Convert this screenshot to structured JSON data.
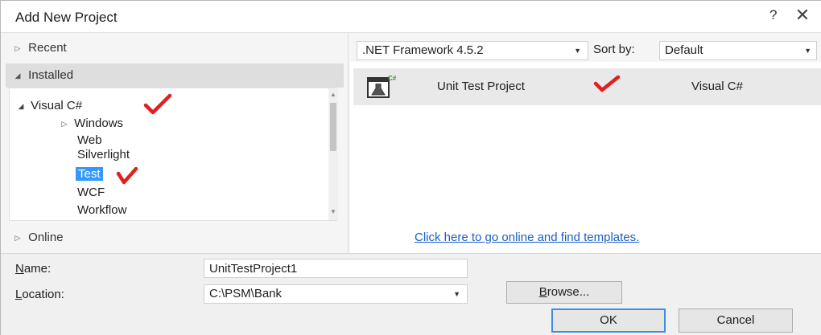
{
  "window": {
    "title": "Add New Project",
    "help_label": "?",
    "close_label": "✕"
  },
  "left": {
    "recent_label": "Recent",
    "installed_label": "Installed",
    "online_label": "Online",
    "tree": {
      "root_label": "Visual C#",
      "items": [
        "Windows",
        "Web",
        "Silverlight",
        "Test",
        "WCF",
        "Workflow"
      ],
      "selected": "Test"
    }
  },
  "toolbar": {
    "framework": ".NET Framework 4.5.2",
    "sort_by_label": "Sort by:",
    "sort_value": "Default"
  },
  "templates": [
    {
      "name": "Unit Test Project",
      "language": "Visual C#",
      "icon": "unit-test-csharp-icon"
    }
  ],
  "online_link": "Click here to go online and find templates.",
  "form": {
    "name_label_ul": "N",
    "name_label_rest": "ame:",
    "name_value": "UnitTestProject1",
    "location_label_ul": "L",
    "location_label_rest": "ocation:",
    "location_value": "C:\\PSM\\Bank",
    "browse_ul": "B",
    "browse_rest": "rowse...",
    "ok_label": "OK",
    "cancel_label": "Cancel"
  },
  "colors": {
    "selection": "#3399ff",
    "link": "#1a5fc4",
    "checkmark": "#e02020"
  }
}
